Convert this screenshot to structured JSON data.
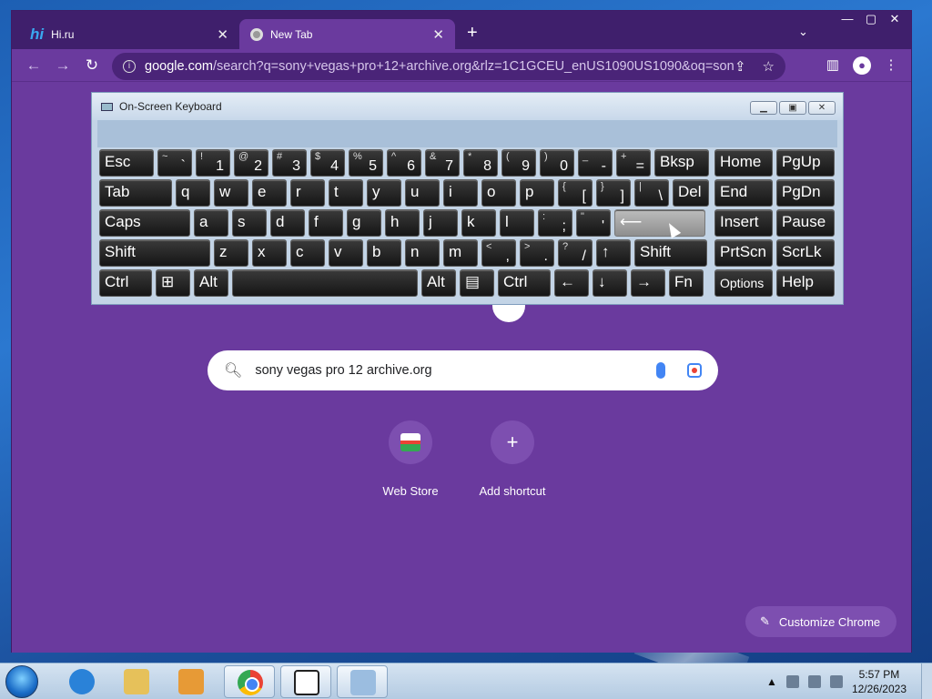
{
  "browser": {
    "tabs": [
      {
        "title": "Hi.ru",
        "icon": "hi-ru-icon",
        "active": false
      },
      {
        "title": "New Tab",
        "icon": "chrome-icon",
        "active": true
      }
    ],
    "url_host": "google.com",
    "url_path": "/search?q=sony+vegas+pro+12+archive.org&rlz=1C1GCEU_enUS1090US1090&oq=sony+veg...",
    "window_controls": [
      "minimize",
      "maximize",
      "close"
    ]
  },
  "ntp": {
    "search_text": "sony vegas pro 12 archive.org",
    "shortcuts": [
      {
        "label": "Web Store",
        "icon": "web-store-icon"
      },
      {
        "label": "Add shortcut",
        "icon": "plus-icon"
      }
    ],
    "customize_label": "Customize Chrome"
  },
  "osk": {
    "title": "On-Screen Keyboard",
    "rows": [
      [
        {
          "main": "Esc"
        },
        {
          "sub": "~",
          "main": "`"
        },
        {
          "sub": "!",
          "main": "1"
        },
        {
          "sub": "@",
          "main": "2"
        },
        {
          "sub": "#",
          "main": "3"
        },
        {
          "sub": "$",
          "main": "4"
        },
        {
          "sub": "%",
          "main": "5"
        },
        {
          "sub": "^",
          "main": "6"
        },
        {
          "sub": "&",
          "main": "7"
        },
        {
          "sub": "*",
          "main": "8"
        },
        {
          "sub": "(",
          "main": "9"
        },
        {
          "sub": ")",
          "main": "0"
        },
        {
          "sub": "_",
          "main": "-"
        },
        {
          "sub": "+",
          "main": "="
        },
        {
          "main": "Bksp"
        },
        {
          "main": "Home"
        },
        {
          "main": "PgUp"
        }
      ],
      [
        {
          "main": "Tab"
        },
        {
          "main": "q"
        },
        {
          "main": "w"
        },
        {
          "main": "e"
        },
        {
          "main": "r"
        },
        {
          "main": "t"
        },
        {
          "main": "y"
        },
        {
          "main": "u"
        },
        {
          "main": "i"
        },
        {
          "main": "o"
        },
        {
          "main": "p"
        },
        {
          "sub": "{",
          "main": "["
        },
        {
          "sub": "}",
          "main": "]"
        },
        {
          "sub": "|",
          "main": "\\"
        },
        {
          "main": "Del"
        },
        {
          "main": "End"
        },
        {
          "main": "PgDn"
        }
      ],
      [
        {
          "main": "Caps"
        },
        {
          "main": "a"
        },
        {
          "main": "s"
        },
        {
          "main": "d"
        },
        {
          "main": "f"
        },
        {
          "main": "g"
        },
        {
          "main": "h"
        },
        {
          "main": "j"
        },
        {
          "main": "k"
        },
        {
          "main": "l"
        },
        {
          "sub": ":",
          "main": ";"
        },
        {
          "sub": "\"",
          "main": "'"
        },
        {
          "main": "⟵",
          "pressed": true
        },
        {
          "main": "Insert"
        },
        {
          "main": "Pause"
        }
      ],
      [
        {
          "main": "Shift"
        },
        {
          "main": "z"
        },
        {
          "main": "x"
        },
        {
          "main": "c"
        },
        {
          "main": "v"
        },
        {
          "main": "b"
        },
        {
          "main": "n"
        },
        {
          "main": "m"
        },
        {
          "sub": "<",
          "main": ","
        },
        {
          "sub": ">",
          "main": "."
        },
        {
          "sub": "?",
          "main": "/"
        },
        {
          "main": "↑"
        },
        {
          "main": "Shift"
        },
        {
          "main": "PrtScn"
        },
        {
          "main": "ScrLk"
        }
      ],
      [
        {
          "main": "Ctrl"
        },
        {
          "main": "⊞"
        },
        {
          "main": "Alt"
        },
        {
          "main": ""
        },
        {
          "main": "Alt"
        },
        {
          "main": "▤"
        },
        {
          "main": "Ctrl"
        },
        {
          "main": "←"
        },
        {
          "main": "↓"
        },
        {
          "main": "→"
        },
        {
          "main": "Fn"
        },
        {
          "main": "Options"
        },
        {
          "main": "Help"
        }
      ]
    ]
  },
  "taskbar": {
    "time": "5:57 PM",
    "date": "12/26/2023",
    "apps": [
      "internet-explorer-icon",
      "file-explorer-icon",
      "media-player-icon",
      "chrome-icon",
      "app-icon",
      "on-screen-keyboard-icon"
    ]
  }
}
